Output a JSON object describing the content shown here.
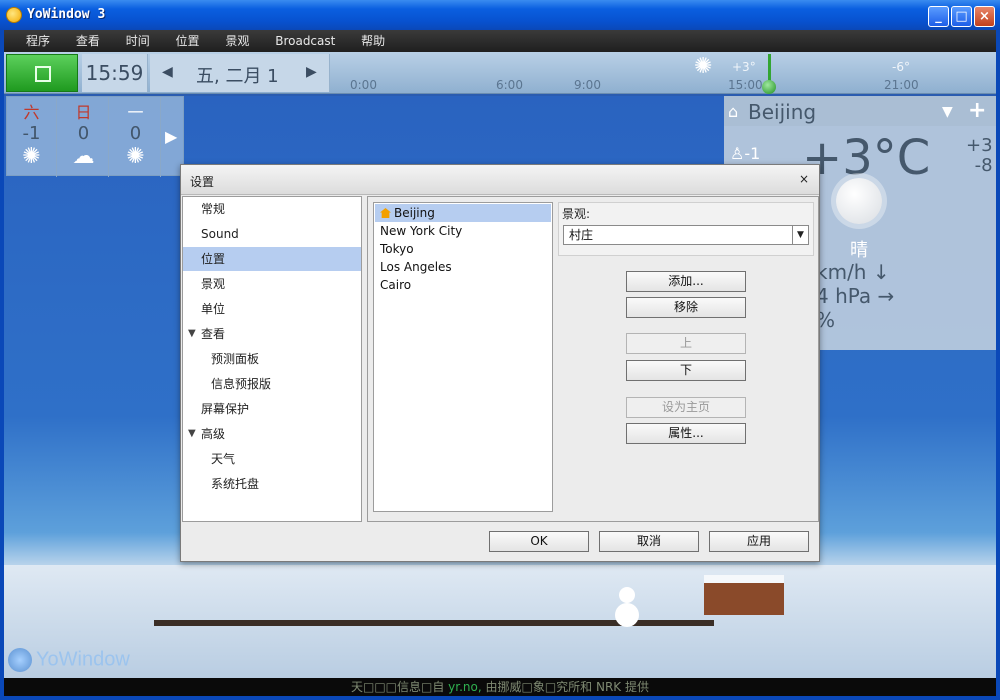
{
  "window": {
    "title": "YoWindow 3"
  },
  "menu": [
    "程序",
    "查看",
    "时间",
    "位置",
    "景观",
    "Broadcast",
    "帮助"
  ],
  "timebar": {
    "time": "15:59",
    "date": "五, 二月 1",
    "ticks": [
      "0:00",
      "6:00",
      "9:00",
      "15:00",
      "21:00"
    ],
    "temps": [
      "+3°",
      "-6°"
    ]
  },
  "forecast": [
    {
      "day": "六",
      "temp": "-1",
      "icon": "sun-icon",
      "color": "#c0392b"
    },
    {
      "day": "日",
      "temp": "0",
      "icon": "cloud-icon",
      "color": "#c0392b"
    },
    {
      "day": "一",
      "temp": "0",
      "icon": "sun-icon",
      "color": "#ffffff"
    }
  ],
  "current": {
    "city": "Beijing",
    "temp": "+3°C",
    "feels": "-1",
    "hi": "+3",
    "lo": "-8",
    "condition": "晴",
    "wind": "km/h ↓",
    "pressure": "4 hPa →",
    "humidity": "%"
  },
  "dialog": {
    "title": "设置",
    "close": "×",
    "nav": [
      {
        "label": "常规",
        "indent": 0
      },
      {
        "label": "Sound",
        "indent": 0
      },
      {
        "label": "位置",
        "indent": 0,
        "selected": true
      },
      {
        "label": "景观",
        "indent": 0
      },
      {
        "label": "单位",
        "indent": 0
      },
      {
        "label": "查看",
        "indent": 0,
        "expanded": true
      },
      {
        "label": "预测面板",
        "indent": 1
      },
      {
        "label": "信息预报版",
        "indent": 1
      },
      {
        "label": "屏幕保护",
        "indent": 0
      },
      {
        "label": "高级",
        "indent": 0,
        "expanded": true
      },
      {
        "label": "天气",
        "indent": 1
      },
      {
        "label": "系统托盘",
        "indent": 1
      }
    ],
    "locations": [
      "Beijing",
      "New York City",
      "Tokyo",
      "Los Angeles",
      "Cairo"
    ],
    "selected_location": "Beijing",
    "scene_label": "景观:",
    "scene_value": "村庄",
    "buttons": {
      "add": "添加...",
      "remove": "移除",
      "up": "上",
      "down": "下",
      "set_home": "设为主页",
      "properties": "属性...",
      "ok": "OK",
      "cancel": "取消",
      "apply": "应用"
    }
  },
  "footer": {
    "credit_pre": "天□□□信息□自 ",
    "credit_link": "yr.no,",
    "credit_post": " 由挪威□象□究所和 NRK 提供"
  },
  "logo": "YoWindow"
}
